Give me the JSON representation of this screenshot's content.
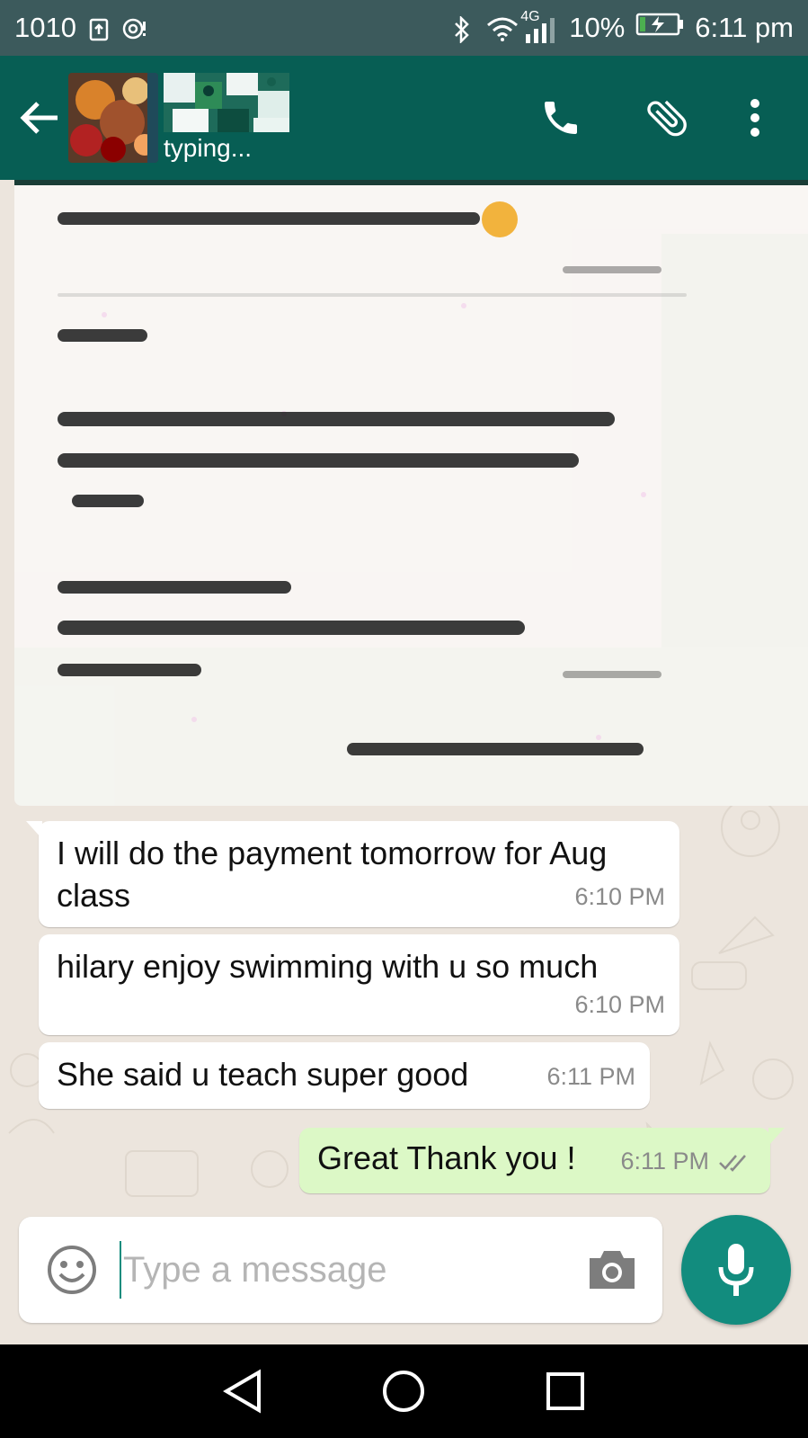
{
  "status_bar": {
    "left_text": "1010",
    "network": "4G",
    "battery": "10%",
    "time": "6:11 pm"
  },
  "header": {
    "contact_status": "typing...",
    "icons": [
      "back-arrow-icon",
      "phone-icon",
      "paperclip-icon",
      "more-vert-icon"
    ]
  },
  "messages": [
    {
      "direction": "in",
      "text": "I will do the payment tomorrow for Aug class",
      "time": "6:10 PM"
    },
    {
      "direction": "in",
      "text": "hilary enjoy swimming with u so much",
      "time": "6:10 PM"
    },
    {
      "direction": "in",
      "text": "She said u teach super good",
      "time": "6:11 PM"
    },
    {
      "direction": "out",
      "text": "Great Thank you !",
      "time": "6:11 PM",
      "ticks": "double-tick-icon"
    }
  ],
  "composer": {
    "placeholder": "Type a message"
  },
  "colors": {
    "header": "#075e54",
    "statusbar": "#3c5a5c",
    "accent": "#128c7e",
    "outgoing_bubble": "#dcf8c6",
    "chat_bg": "#ece5dd"
  }
}
